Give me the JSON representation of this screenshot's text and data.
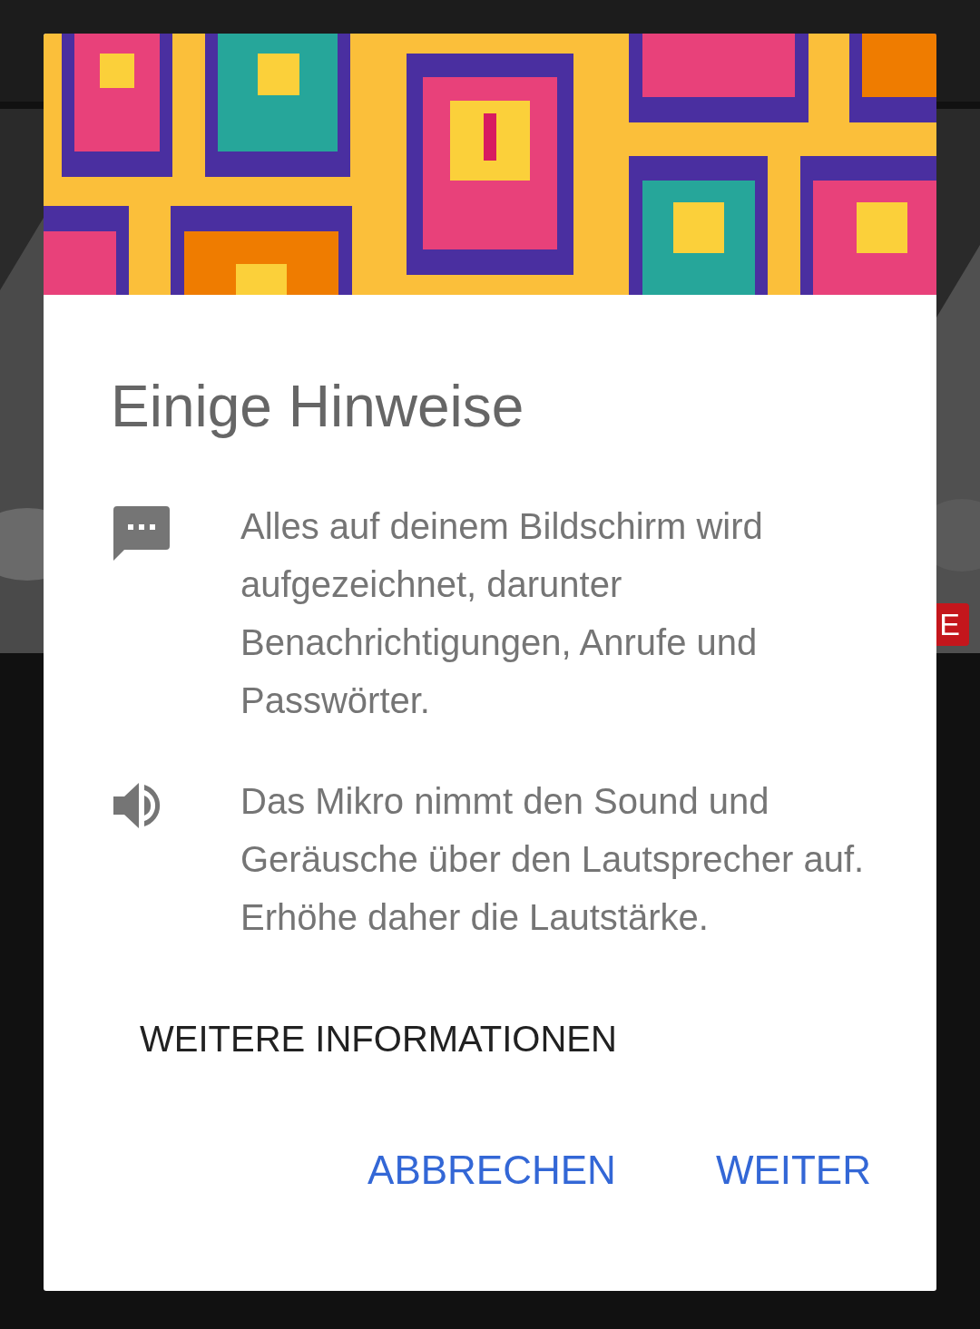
{
  "background": {
    "live_badge": "E"
  },
  "dialog": {
    "title": "Einige Hinweise",
    "notes": [
      {
        "kind": "chat",
        "text": "Alles auf deinem Bildschirm wird aufgezeichnet, darunter Benachrichtigungen, Anrufe und Passwörter."
      },
      {
        "kind": "sound",
        "text": "Das Mikro nimmt den Sound und Geräusche über den Lautsprecher auf. Erhöhe daher die Lautstärke."
      }
    ],
    "link": "WEITERE INFORMATIONEN",
    "buttons": [
      "ABBRECHEN",
      "WEITER"
    ]
  }
}
